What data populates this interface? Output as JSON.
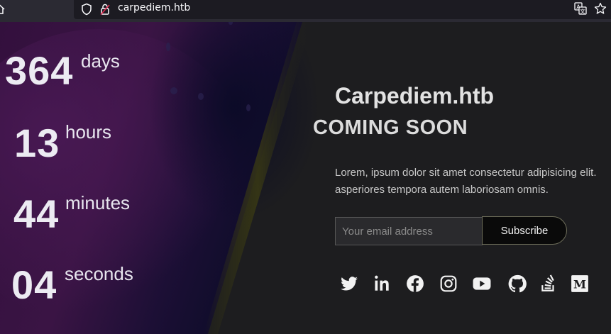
{
  "browser": {
    "url": "carpediem.htb"
  },
  "countdown": {
    "days": {
      "value": "364",
      "unit": "days"
    },
    "hours": {
      "value": "13",
      "unit": "hours"
    },
    "minutes": {
      "value": "44",
      "unit": "minutes"
    },
    "seconds": {
      "value": "04",
      "unit": "seconds"
    }
  },
  "hero": {
    "title": "Carpediem.htb",
    "subtitle": "COMING SOON",
    "description_line1": "Lorem, ipsum dolor sit amet consectetur adipisicing elit.",
    "description_line2": "asperiores tempora autem laboriosam omnis."
  },
  "newsletter": {
    "email_placeholder": "Your email address",
    "subscribe_label": "Subscribe"
  },
  "social_links": [
    "twitter-icon",
    "linkedin-icon",
    "facebook-icon",
    "instagram-icon",
    "youtube-icon",
    "github-icon",
    "stack-overflow-icon",
    "medium-icon"
  ],
  "colors": {
    "page_background": "#1d1d1f",
    "panel_purple": "#3a1444",
    "panel_navy": "#0d0d2a",
    "divider_glow": "#4a4a10"
  }
}
